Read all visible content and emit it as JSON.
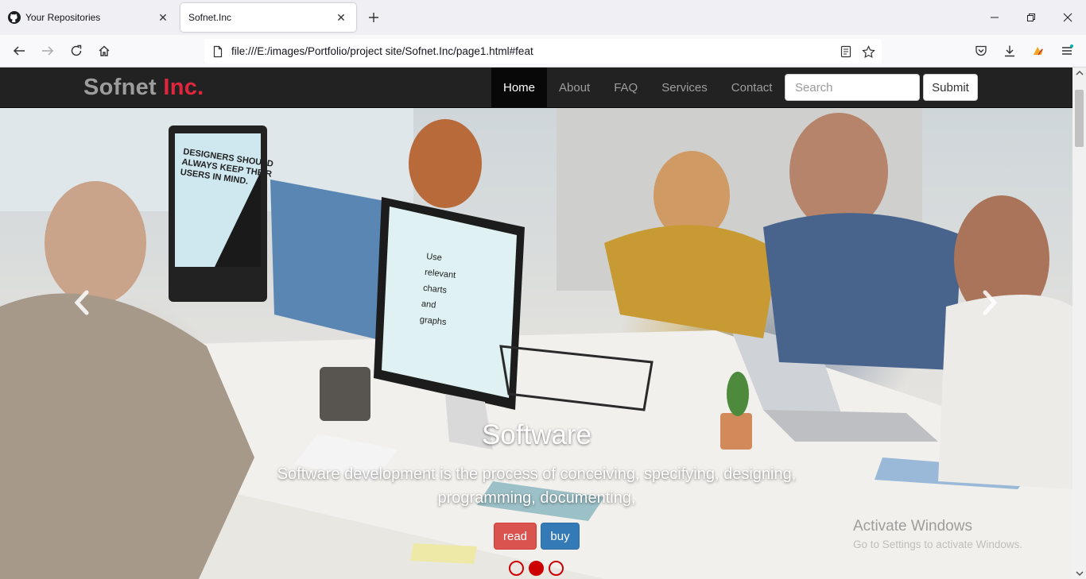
{
  "browser": {
    "tabs": [
      {
        "title": "Your Repositories",
        "favicon": "github-icon",
        "active": false
      },
      {
        "title": "Sofnet.Inc",
        "favicon": "",
        "active": true
      }
    ],
    "url": "file:///E:/images/Portfolio/project site/Sofnet.Inc/page1.html#feat"
  },
  "site": {
    "brand": {
      "name": "Sofnet",
      "accent": "Inc.",
      "accent_color": "#e0263d"
    },
    "nav": [
      {
        "label": "Home",
        "active": true
      },
      {
        "label": "About",
        "active": false
      },
      {
        "label": "FAQ",
        "active": false
      },
      {
        "label": "Services",
        "active": false
      },
      {
        "label": "Contact",
        "active": false
      }
    ],
    "search": {
      "placeholder": "Search",
      "value": ""
    },
    "submit_label": "Submit"
  },
  "hero": {
    "title": "Software",
    "text": "Software development is the process of conceiving, specifying, designing, programming, documenting,",
    "read_label": "read",
    "buy_label": "buy",
    "indicators": {
      "count": 3,
      "active_index": 1,
      "color": "#cc0000"
    },
    "prev_icon": "chevron-left-icon",
    "next_icon": "chevron-right-icon",
    "monitor_note": "DESIGNERS SHOULD ALWAYS KEEP THEIR USERS IN MIND.",
    "screen_text": [
      "Use",
      "relevant",
      "charts",
      "and",
      "graphs"
    ]
  },
  "watermark": {
    "title": "Activate Windows",
    "subtitle": "Go to Settings to activate Windows."
  }
}
